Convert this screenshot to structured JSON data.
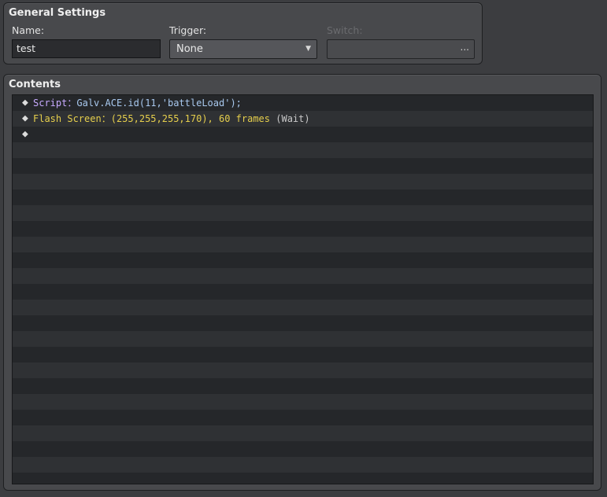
{
  "general": {
    "title": "General Settings",
    "name_label": "Name:",
    "name_value": "test",
    "trigger_label": "Trigger:",
    "trigger_value": "None",
    "switch_label": "Switch:",
    "switch_button": "..."
  },
  "contents": {
    "title": "Contents",
    "commands": [
      {
        "name": "Script",
        "sep": "：",
        "args": "Galv.ACE.id(11,'battleLoad');",
        "extra": ""
      },
      {
        "name": "Flash Screen",
        "sep": "：",
        "args": "(255,255,255,170), 60 frames",
        "extra": " (Wait)"
      },
      {
        "name": "",
        "sep": "",
        "args": "",
        "extra": ""
      }
    ],
    "bullet": "◆"
  },
  "colors": {
    "script": "#c7aaff",
    "script_args": "#a8c8ee",
    "flash": "#e6cf4c",
    "wait": "#c9c9c9"
  }
}
